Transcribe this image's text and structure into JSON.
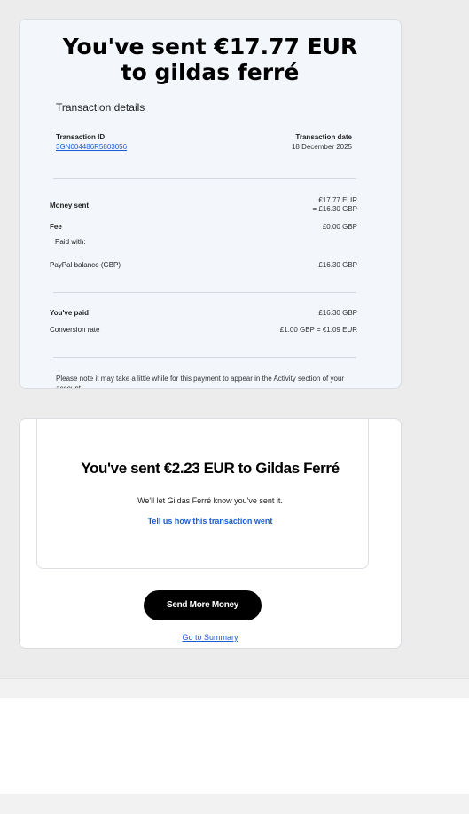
{
  "receipt": {
    "title_line1": "You've sent €17.77 EUR",
    "title_line2": "to gildas ferré",
    "section_heading": "Transaction details",
    "transaction_id_label": "Transaction ID",
    "transaction_id": "3GN004486R5803056",
    "transaction_date_label": "Transaction date",
    "transaction_date": "18 December 2025",
    "money_sent_label": "Money sent",
    "money_sent_eur": "€17.77 EUR",
    "money_sent_gbp": "= £16.30 GBP",
    "fee_label": "Fee",
    "fee_value": "£0.00 GBP",
    "paid_with_label": "Paid with:",
    "paypal_balance_label": "PayPal balance (GBP)",
    "paypal_balance_value": "£16.30 GBP",
    "youve_paid_label": "You've paid",
    "youve_paid_value": "£16.30 GBP",
    "conversion_label": "Conversion rate",
    "conversion_value": "£1.00 GBP = €1.09 EUR",
    "note": "Please note it may take a little while for this payment to appear in the Activity section of your account."
  },
  "confirmation": {
    "title": "You've sent €2.23 EUR to Gildas Ferré",
    "subtitle": "We'll let Gildas Ferré know you've sent it.",
    "feedback_link": "Tell us how this transaction went",
    "send_more_button": "Send More Money",
    "summary_link": "Go to Summary"
  },
  "colors": {
    "link": "#1a5bd6",
    "button": "#000000",
    "receipt_bg": "#f3f6fb"
  }
}
